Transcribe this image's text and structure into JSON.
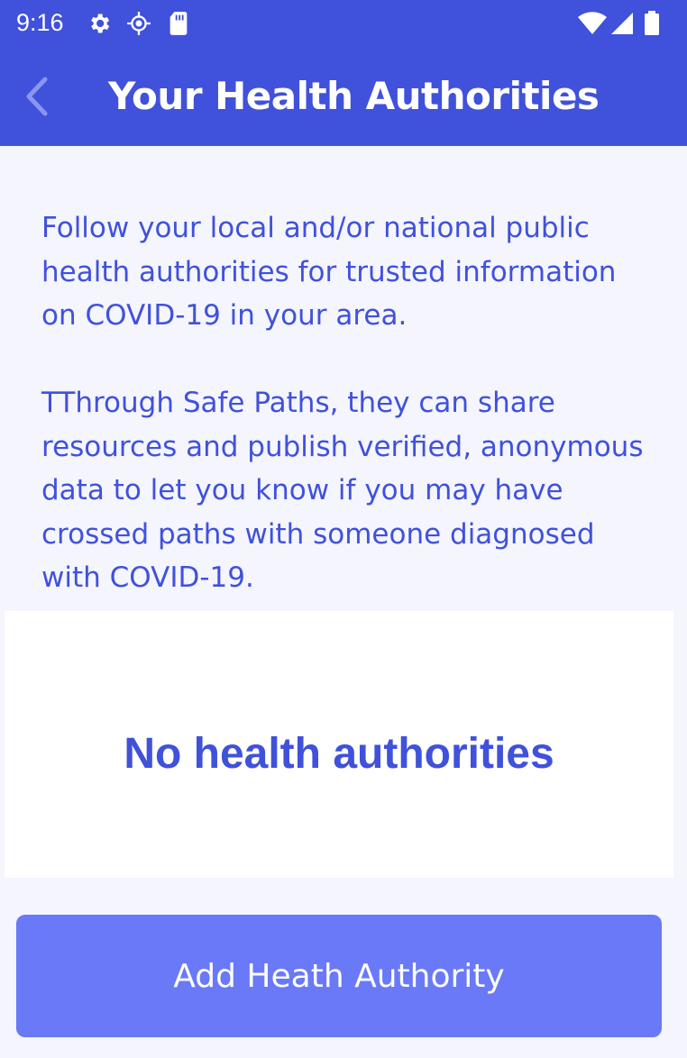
{
  "status_bar": {
    "time": "9:16",
    "left_icons": [
      "gear-icon",
      "location-icon",
      "sd-card-icon"
    ],
    "right_icons": [
      "wifi-icon",
      "cell-signal-icon",
      "battery-icon"
    ]
  },
  "app_bar": {
    "title": "Your Health Authorities",
    "back_icon": "chevron-left-icon"
  },
  "intro": {
    "paragraph_1": "Follow your local and/or national public health authorities for trusted information on COVID-19 in your area.",
    "paragraph_2": "TThrough Safe Paths, they can share resources and publish verified, anonymous data to let you know if you may have crossed paths with someone diagnosed with COVID-19."
  },
  "authorities_list": {
    "empty_text": "No health authorities"
  },
  "actions": {
    "add_button_label": "Add Heath Authority"
  },
  "colors": {
    "primary": "#4051DB",
    "button": "#6979F8",
    "background": "#F4F5FD",
    "card": "#FFFFFF"
  }
}
